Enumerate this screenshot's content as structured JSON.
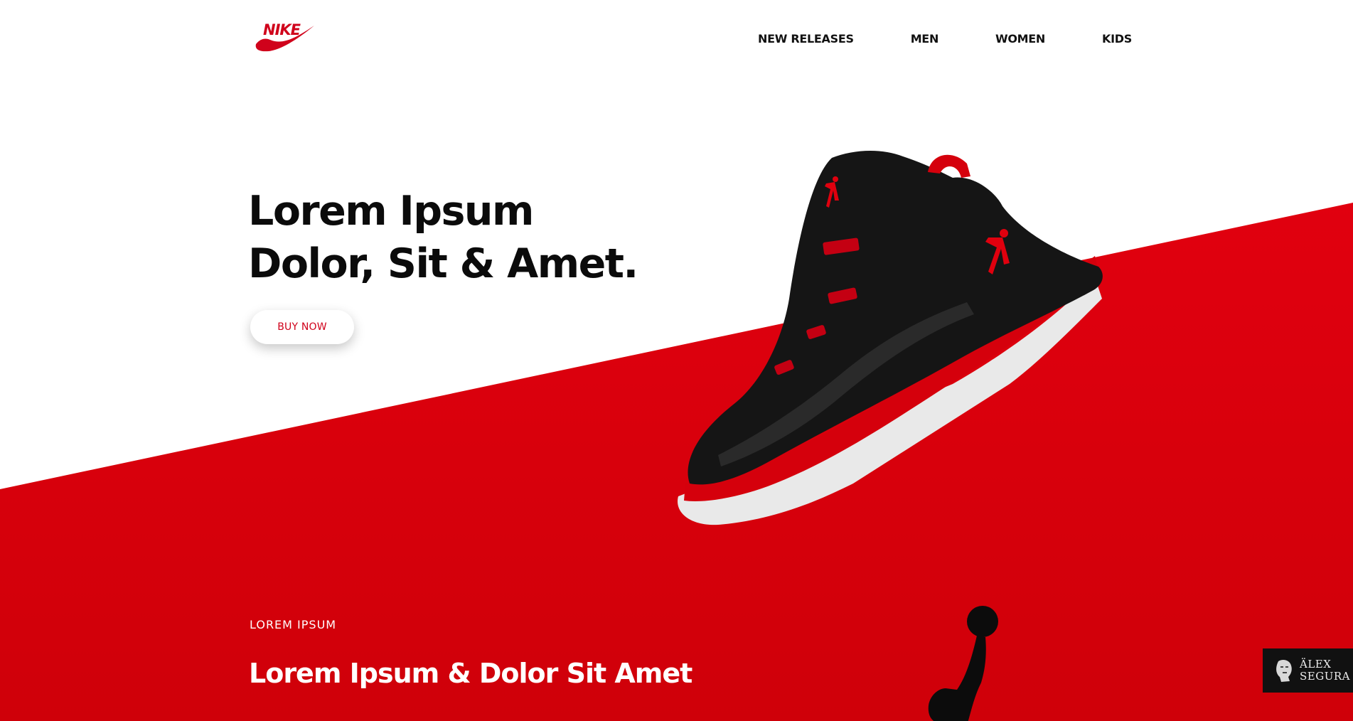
{
  "brand": {
    "name": "NIKE",
    "color": "#d0021b"
  },
  "nav": {
    "items": [
      {
        "label": "NEW RELEASES"
      },
      {
        "label": "MEN"
      },
      {
        "label": "WOMEN"
      },
      {
        "label": "KIDS"
      }
    ]
  },
  "hero": {
    "title_line1": "Lorem Ipsum",
    "title_line2": "Dolor, Sit & Amet.",
    "cta_label": "BUY NOW"
  },
  "section": {
    "eyebrow": "LOREM IPSUM",
    "title": "Lorem Ipsum & Dolor Sit Amet"
  },
  "author_badge": {
    "line1": "ÄLEX",
    "line2": "SEGURA"
  },
  "colors": {
    "accent_red": "#d9000d",
    "text_dark": "#0b0b0b",
    "badge_bg": "#111111"
  },
  "icons": {
    "logo": "nike-swoosh-icon",
    "product": "basketball-shoe-image",
    "silhouette": "jumpman-silhouette-icon",
    "author": "author-face-icon"
  }
}
